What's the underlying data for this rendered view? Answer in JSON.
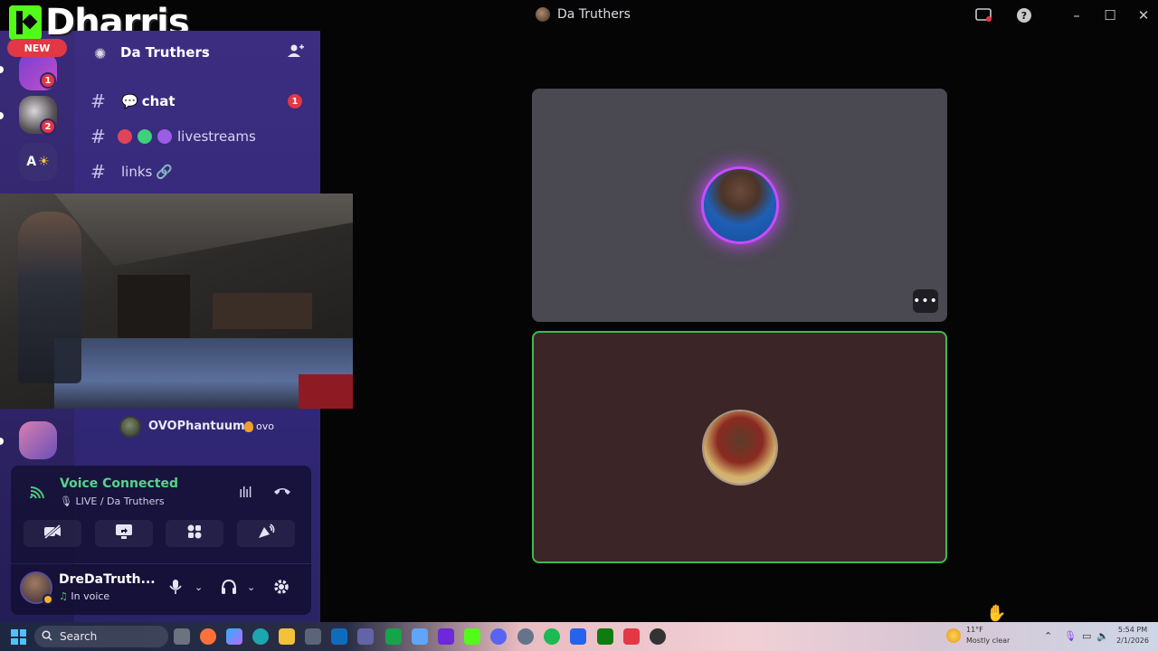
{
  "window": {
    "title": "Da Truthers"
  },
  "overlay": {
    "streamer_name": "Dharris",
    "new_badge": "NEW"
  },
  "rail": {
    "badges": [
      "1",
      "2"
    ],
    "text_icon": "A"
  },
  "server": {
    "name": "Da Truthers",
    "channels": [
      {
        "label": "chat",
        "badge": "1",
        "emoji": "💬"
      },
      {
        "label": "livestreams"
      },
      {
        "label": "links",
        "emoji": "🔗"
      }
    ]
  },
  "voice_member": {
    "name": "OVOPhantuums",
    "tag": "ovo"
  },
  "voice": {
    "title": "Voice Connected",
    "subtitle": "LIVE / Da Truthers"
  },
  "user": {
    "name": "DreDaTruth...",
    "status": "In voice"
  },
  "taskbar": {
    "search_placeholder": "Search",
    "weather_temp": "11°F",
    "weather_cond": "Mostly clear",
    "time": "5:54 PM",
    "date": "2/1/2026"
  },
  "colors": {
    "accent_green": "#3fb950",
    "badge_red": "#e23745",
    "speaking_glow": "#c84cff"
  }
}
